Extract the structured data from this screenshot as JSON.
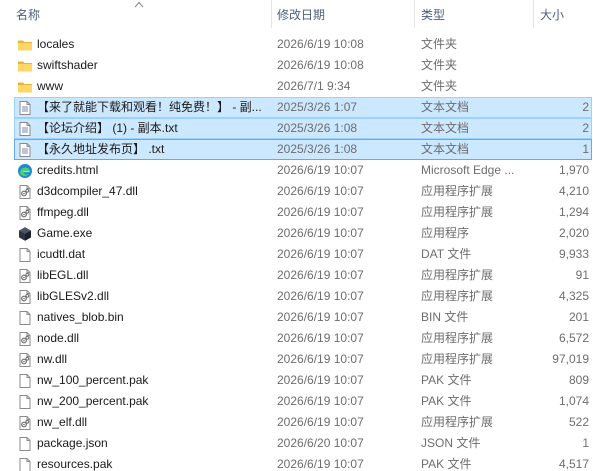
{
  "columns": {
    "name": "名称",
    "date": "修改日期",
    "type": "类型",
    "size": "大小"
  },
  "files": [
    {
      "name": "locales",
      "date": "2026/6/19 10:08",
      "type": "文件夹",
      "size": "",
      "icon": "folder-icon"
    },
    {
      "name": "swiftshader",
      "date": "2026/6/19 10:08",
      "type": "文件夹",
      "size": "",
      "icon": "folder-icon"
    },
    {
      "name": "www",
      "date": "2026/7/1 9:34",
      "type": "文件夹",
      "size": "",
      "icon": "folder-icon"
    },
    {
      "name": "【来了就能下载和观看！纯免费！】 - 副...",
      "date": "2025/3/26 1:07",
      "type": "文本文档",
      "size": "2",
      "icon": "text-file-icon",
      "selected": true
    },
    {
      "name": "【论坛介绍】 (1) - 副本.txt",
      "date": "2025/3/26 1:08",
      "type": "文本文档",
      "size": "2",
      "icon": "text-file-icon",
      "selected": true
    },
    {
      "name": "【永久地址发布页】 .txt",
      "date": "2025/3/26 1:08",
      "type": "文本文档",
      "size": "1",
      "icon": "text-file-icon",
      "selected": true,
      "focused": true
    },
    {
      "name": "credits.html",
      "date": "2026/6/19 10:07",
      "type": "Microsoft Edge ...",
      "size": "1,970",
      "icon": "edge-icon"
    },
    {
      "name": "d3dcompiler_47.dll",
      "date": "2026/6/19 10:07",
      "type": "应用程序扩展",
      "size": "4,210",
      "icon": "dll-icon"
    },
    {
      "name": "ffmpeg.dll",
      "date": "2026/6/19 10:07",
      "type": "应用程序扩展",
      "size": "1,294",
      "icon": "dll-icon"
    },
    {
      "name": "Game.exe",
      "date": "2026/6/19 10:07",
      "type": "应用程序",
      "size": "2,020",
      "icon": "exe-icon"
    },
    {
      "name": "icudtl.dat",
      "date": "2026/6/19 10:07",
      "type": "DAT 文件",
      "size": "9,933",
      "icon": "blank-file-icon"
    },
    {
      "name": "libEGL.dll",
      "date": "2026/6/19 10:07",
      "type": "应用程序扩展",
      "size": "91",
      "icon": "dll-icon"
    },
    {
      "name": "libGLESv2.dll",
      "date": "2026/6/19 10:07",
      "type": "应用程序扩展",
      "size": "4,325",
      "icon": "dll-icon"
    },
    {
      "name": "natives_blob.bin",
      "date": "2026/6/19 10:07",
      "type": "BIN 文件",
      "size": "201",
      "icon": "blank-file-icon"
    },
    {
      "name": "node.dll",
      "date": "2026/6/19 10:07",
      "type": "应用程序扩展",
      "size": "6,572",
      "icon": "dll-icon"
    },
    {
      "name": "nw.dll",
      "date": "2026/6/19 10:07",
      "type": "应用程序扩展",
      "size": "97,019",
      "icon": "dll-icon"
    },
    {
      "name": "nw_100_percent.pak",
      "date": "2026/6/19 10:07",
      "type": "PAK 文件",
      "size": "809",
      "icon": "blank-file-icon"
    },
    {
      "name": "nw_200_percent.pak",
      "date": "2026/6/19 10:07",
      "type": "PAK 文件",
      "size": "1,074",
      "icon": "blank-file-icon"
    },
    {
      "name": "nw_elf.dll",
      "date": "2026/6/19 10:07",
      "type": "应用程序扩展",
      "size": "522",
      "icon": "dll-icon"
    },
    {
      "name": "package.json",
      "date": "2026/6/20 10:07",
      "type": "JSON 文件",
      "size": "1",
      "icon": "blank-file-icon"
    },
    {
      "name": "resources.pak",
      "date": "2026/6/19 10:07",
      "type": "PAK 文件",
      "size": "4,517",
      "icon": "blank-file-icon"
    }
  ],
  "colors": {
    "selection_bg": "#cce8ff",
    "selection_border": "#99d1ff",
    "folder": "#ffd766",
    "header_text": "#4c607a"
  }
}
